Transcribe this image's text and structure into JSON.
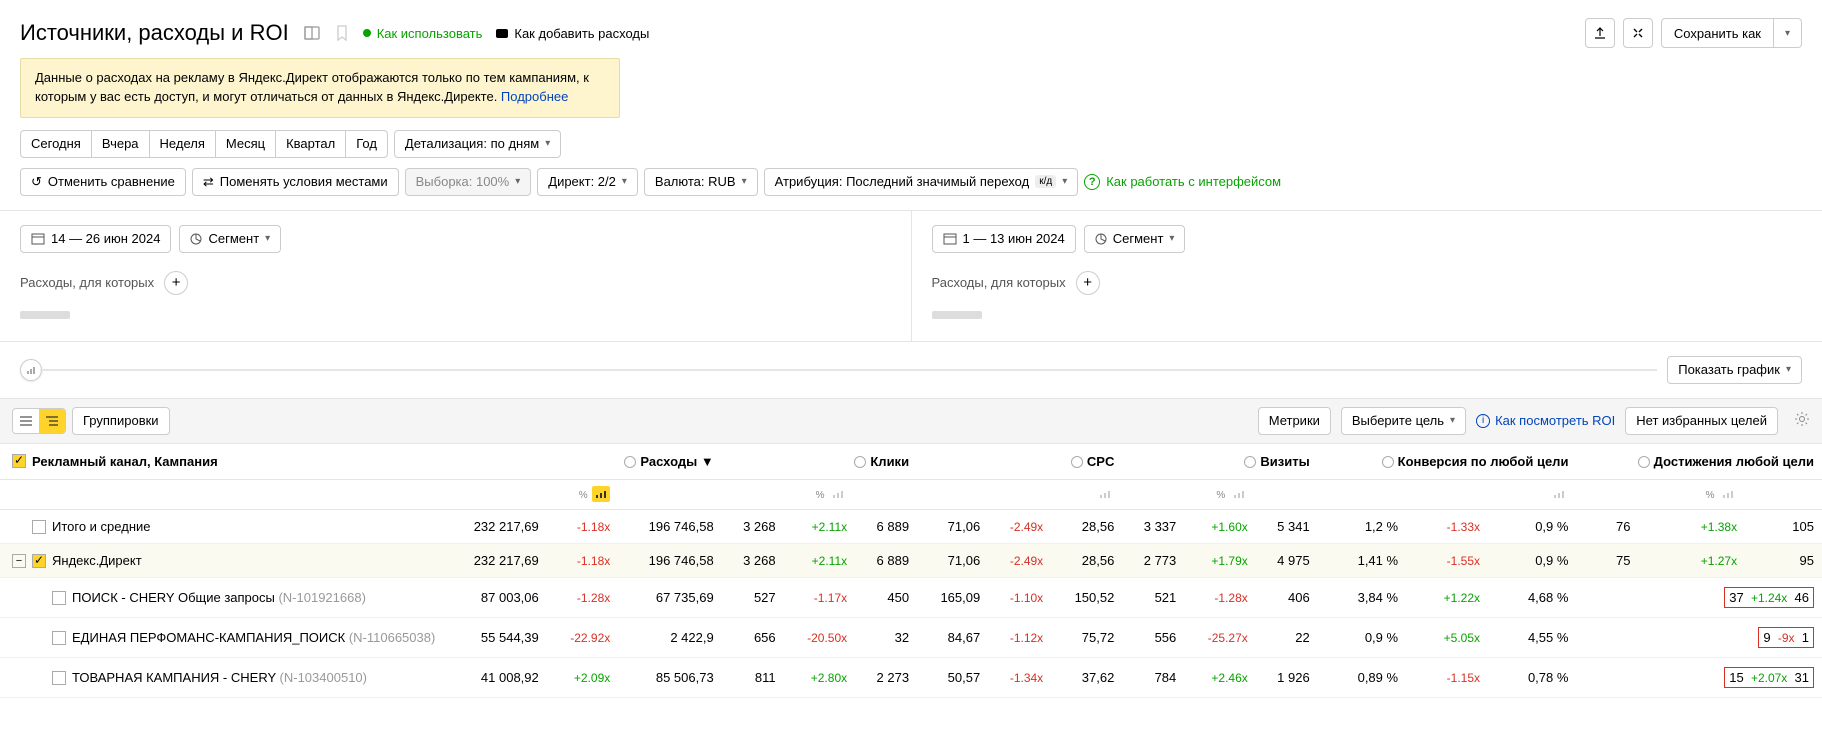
{
  "header": {
    "title": "Источники, расходы и ROI",
    "howToUse": "Как использовать",
    "howToAddExpenses": "Как добавить расходы",
    "saveAs": "Сохранить как"
  },
  "notice": {
    "text": "Данные о расходах на рекламу в Яндекс.Директ отображаются только по тем кампаниям, к которым у вас есть доступ, и могут отличаться от данных в Яндекс.Директе. ",
    "link": "Подробнее"
  },
  "periods": {
    "today": "Сегодня",
    "yesterday": "Вчера",
    "week": "Неделя",
    "month": "Месяц",
    "quarter": "Квартал",
    "year": "Год"
  },
  "detail": "Детализация: по дням",
  "filters": {
    "cancelCompare": "Отменить сравнение",
    "swap": "Поменять условия местами",
    "sample": "Выборка: 100%",
    "direct": "Директ: 2/2",
    "currency": "Валюта: RUB",
    "attribution": "Атрибуция: Последний значимый переход",
    "kd": "к/д",
    "interfaceHelp": "Как работать с интерфейсом"
  },
  "compare": {
    "left": {
      "date": "14 — 26 июн 2024",
      "segment": "Сегмент",
      "expenseLabel": "Расходы, для которых"
    },
    "right": {
      "date": "1 — 13 июн 2024",
      "segment": "Сегмент",
      "expenseLabel": "Расходы, для которых"
    }
  },
  "showGraph": "Показать график",
  "toolbar2": {
    "groupings": "Группировки",
    "metrics": "Метрики",
    "selectGoal": "Выберите цель",
    "howRoi": "Как посмотреть ROI",
    "noFavGoals": "Нет избранных целей"
  },
  "columns": {
    "dim": "Рекламный канал, Кампания",
    "expenses": "Расходы",
    "clicks": "Клики",
    "cpc": "CPC",
    "visits": "Визиты",
    "convAny": "Конверсия по любой цели",
    "achAny": "Достижения любой цели"
  },
  "rows": [
    {
      "name": "Итого и средние",
      "pad": 0,
      "expand": "",
      "cb": "empty",
      "exp_a": "232 217,69",
      "exp_d": "-1.18x",
      "exp_b": "196 746,58",
      "clk_a": "3 268",
      "clk_d": "+2.11x",
      "clk_b": "6 889",
      "cpc_a": "71,06",
      "cpc_d": "-2.49x",
      "cpc_b": "28,56",
      "vis_a": "3 337",
      "vis_d": "+1.60x",
      "vis_b": "5 341",
      "cnv_a": "1,2 %",
      "cnv_d": "-1.33x",
      "cnv_b": "0,9 %",
      "ach_a": "76",
      "ach_d": "+1.38x",
      "ach_b": "105",
      "box": false
    },
    {
      "name": "Яндекс.Директ",
      "pad": 1,
      "expand": "−",
      "cb": "checked",
      "hl": true,
      "exp_a": "232 217,69",
      "exp_d": "-1.18x",
      "exp_b": "196 746,58",
      "clk_a": "3 268",
      "clk_d": "+2.11x",
      "clk_b": "6 889",
      "cpc_a": "71,06",
      "cpc_d": "-2.49x",
      "cpc_b": "28,56",
      "vis_a": "2 773",
      "vis_d": "+1.79x",
      "vis_b": "4 975",
      "cnv_a": "1,41 %",
      "cnv_d": "-1.55x",
      "cnv_b": "0,9 %",
      "ach_a": "75",
      "ach_d": "+1.27x",
      "ach_b": "95",
      "box": false
    },
    {
      "name": "ПОИСК - CHERY Общие запросы ",
      "id": "(N-101921668)",
      "pad": 2,
      "expand": "",
      "cb": "empty",
      "exp_a": "87 003,06",
      "exp_d": "-1.28x",
      "exp_b": "67 735,69",
      "clk_a": "527",
      "clk_d": "-1.17x",
      "clk_b": "450",
      "cpc_a": "165,09",
      "cpc_d": "-1.10x",
      "cpc_b": "150,52",
      "vis_a": "521",
      "vis_d": "-1.28x",
      "vis_b": "406",
      "cnv_a": "3,84 %",
      "cnv_d": "+1.22x",
      "cnv_b": "4,68 %",
      "ach_a": "37",
      "ach_d": "+1.24x",
      "ach_b": "46",
      "box": true
    },
    {
      "name": "ЕДИНАЯ ПЕРФОМАНС-КАМПАНИЯ_ПОИСК ",
      "id": "(N-110665038)",
      "pad": 2,
      "expand": "",
      "cb": "empty",
      "exp_a": "55 544,39",
      "exp_d": "-22.92x",
      "exp_b": "2 422,9",
      "clk_a": "656",
      "clk_d": "-20.50x",
      "clk_b": "32",
      "cpc_a": "84,67",
      "cpc_d": "-1.12x",
      "cpc_b": "75,72",
      "vis_a": "556",
      "vis_d": "-25.27x",
      "vis_b": "22",
      "cnv_a": "0,9 %",
      "cnv_d": "+5.05x",
      "cnv_b": "4,55 %",
      "ach_a": "9",
      "ach_d": "-9x",
      "ach_b": "1",
      "box": true
    },
    {
      "name": "ТОВАРНАЯ КАМПАНИЯ - CHERY ",
      "id": "(N-103400510)",
      "pad": 2,
      "expand": "",
      "cb": "empty",
      "exp_a": "41 008,92",
      "exp_d": "+2.09x",
      "exp_b": "85 506,73",
      "clk_a": "811",
      "clk_d": "+2.80x",
      "clk_b": "2 273",
      "cpc_a": "50,57",
      "cpc_d": "-1.34x",
      "cpc_b": "37,62",
      "vis_a": "784",
      "vis_d": "+2.46x",
      "vis_b": "1 926",
      "cnv_a": "0,89 %",
      "cnv_d": "-1.15x",
      "cnv_b": "0,78 %",
      "ach_a": "15",
      "ach_d": "+2.07x",
      "ach_b": "31",
      "box": true
    }
  ]
}
